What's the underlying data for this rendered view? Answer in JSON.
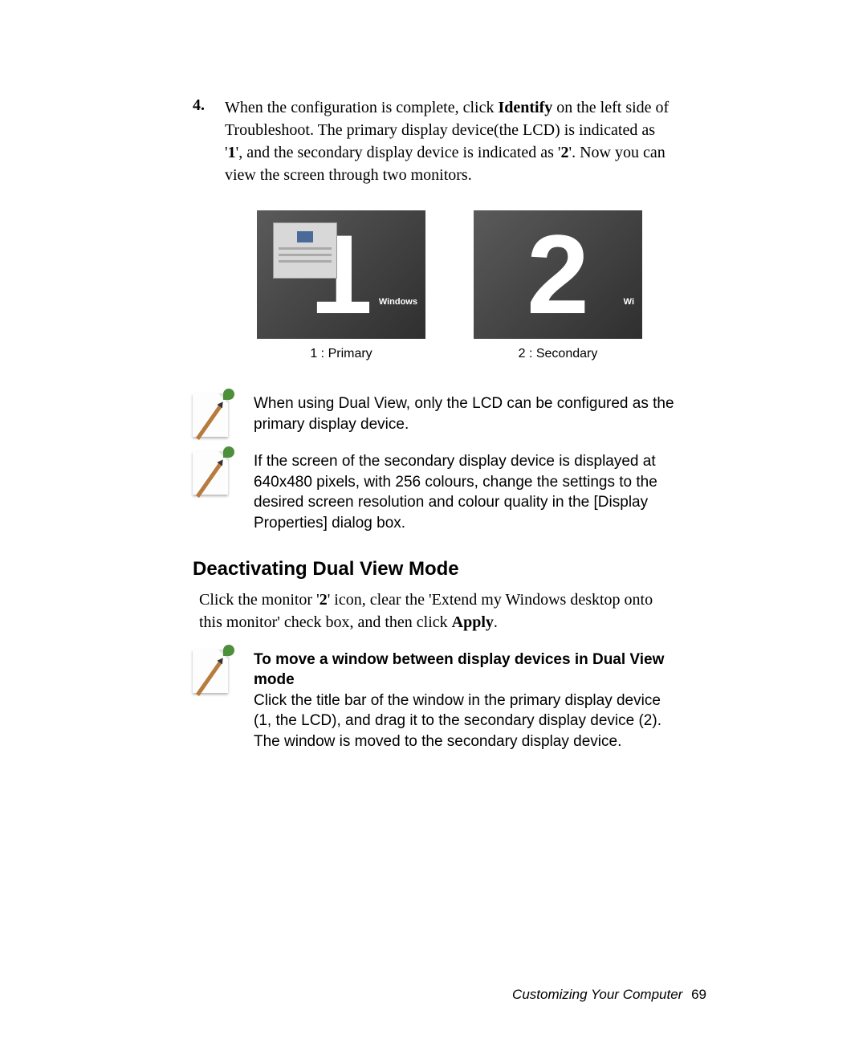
{
  "step4": {
    "number": "4.",
    "text_before_identify": "When the configuration is complete, click ",
    "identify": "Identify",
    "text_mid1": " on the left side of Troubleshoot. The primary display device(the LCD) is indicated as '",
    "one": "1",
    "text_mid2": "', and the secondary display device is indicated as '",
    "two": "2",
    "text_after": "'. Now you can view the screen through two monitors."
  },
  "figures": {
    "fig1_big": "1",
    "fig1_label": "Windows",
    "fig1_caption": "1 : Primary",
    "fig2_big": "2",
    "fig2_label": "Wi",
    "fig2_caption": "2 : Secondary"
  },
  "notes": {
    "n1": "When using Dual View, only the LCD can be configured as the primary display device.",
    "n2": "If the screen of the secondary display device is displayed at 640x480 pixels, with 256 colours, change the settings to the desired screen resolution and colour quality in the [Display Properties] dialog box.",
    "n3_title": "To move a window between display devices in Dual View mode",
    "n3_body": "Click the title bar of the window in the primary display device (1, the LCD), and drag it to the secondary display device (2). The window is moved to the secondary display device."
  },
  "section": {
    "heading": "Deactivating Dual View Mode",
    "body_a": "Click the monitor '",
    "body_two": "2",
    "body_b": "' icon, clear the 'Extend my Windows desktop onto this monitor' check box, and then click ",
    "body_apply": "Apply",
    "body_c": "."
  },
  "footer": {
    "text": "Customizing Your Computer",
    "page": "69"
  }
}
